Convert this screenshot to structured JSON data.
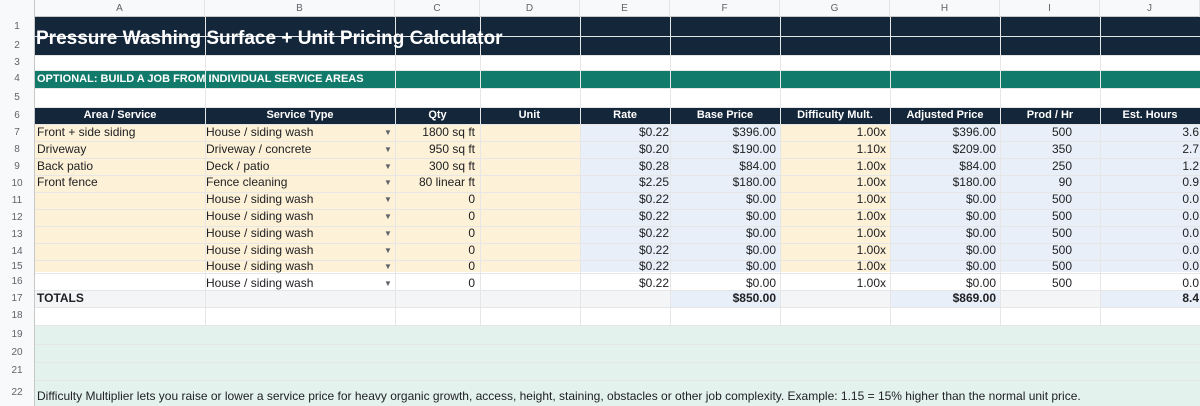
{
  "sheet": {
    "columns": [
      "A",
      "B",
      "C",
      "D",
      "E",
      "F",
      "G",
      "H",
      "I",
      "J"
    ],
    "row_numbers": [
      "1",
      "2",
      "3",
      "4",
      "5",
      "6",
      "7",
      "8",
      "9",
      "10",
      "11",
      "12",
      "13",
      "14",
      "15",
      "16",
      "17",
      "18",
      "19",
      "20",
      "21",
      "22"
    ],
    "title": "Pressure Washing Surface + Unit Pricing Calculator",
    "section_label": "OPTIONAL: BUILD A JOB FROM INDIVIDUAL SERVICE AREAS",
    "headers": {
      "area": "Area / Service",
      "service_type": "Service Type",
      "qty": "Qty",
      "unit": "Unit",
      "rate": "Rate",
      "base_price": "Base Price",
      "difficulty": "Difficulty Mult.",
      "adjusted": "Adjusted Price",
      "prod": "Prod / Hr",
      "hours": "Est. Hours"
    },
    "dropdown_glyph": "▼",
    "rows": [
      {
        "area": "Front + side siding",
        "service": "House / siding wash",
        "qty": "1800 sq ft",
        "unit": "",
        "rate": "$0.22",
        "base": "$396.00",
        "mult": "1.00x",
        "adj": "$396.00",
        "prod": "500",
        "hours": "3.6"
      },
      {
        "area": "Driveway",
        "service": "Driveway / concrete",
        "qty": "950 sq ft",
        "unit": "",
        "rate": "$0.20",
        "base": "$190.00",
        "mult": "1.10x",
        "adj": "$209.00",
        "prod": "350",
        "hours": "2.7"
      },
      {
        "area": "Back patio",
        "service": "Deck / patio",
        "qty": "300 sq ft",
        "unit": "",
        "rate": "$0.28",
        "base": "$84.00",
        "mult": "1.00x",
        "adj": "$84.00",
        "prod": "250",
        "hours": "1.2"
      },
      {
        "area": "Front fence",
        "service": "Fence cleaning",
        "qty": "80 linear ft",
        "unit": "",
        "rate": "$2.25",
        "base": "$180.00",
        "mult": "1.00x",
        "adj": "$180.00",
        "prod": "90",
        "hours": "0.9"
      },
      {
        "area": "",
        "service": "House / siding wash",
        "qty": "0",
        "unit": "",
        "rate": "$0.22",
        "base": "$0.00",
        "mult": "1.00x",
        "adj": "$0.00",
        "prod": "500",
        "hours": "0.0"
      },
      {
        "area": "",
        "service": "House / siding wash",
        "qty": "0",
        "unit": "",
        "rate": "$0.22",
        "base": "$0.00",
        "mult": "1.00x",
        "adj": "$0.00",
        "prod": "500",
        "hours": "0.0"
      },
      {
        "area": "",
        "service": "House / siding wash",
        "qty": "0",
        "unit": "",
        "rate": "$0.22",
        "base": "$0.00",
        "mult": "1.00x",
        "adj": "$0.00",
        "prod": "500",
        "hours": "0.0"
      },
      {
        "area": "",
        "service": "House / siding wash",
        "qty": "0",
        "unit": "",
        "rate": "$0.22",
        "base": "$0.00",
        "mult": "1.00x",
        "adj": "$0.00",
        "prod": "500",
        "hours": "0.0"
      },
      {
        "area": "",
        "service": "House / siding wash",
        "qty": "0",
        "unit": "",
        "rate": "$0.22",
        "base": "$0.00",
        "mult": "1.00x",
        "adj": "$0.00",
        "prod": "500",
        "hours": "0.0"
      },
      {
        "area": "",
        "service": "House / siding wash",
        "qty": "0",
        "unit": "",
        "rate": "$0.22",
        "base": "$0.00",
        "mult": "1.00x",
        "adj": "$0.00",
        "prod": "500",
        "hours": "0.0"
      }
    ],
    "totals": {
      "label": "TOTALS",
      "base": "$850.00",
      "adj": "$869.00",
      "hours": "8.4"
    },
    "note": "Difficulty Multiplier lets you raise or lower a service price for heavy organic growth, access, height, staining, obstacles or other job complexity. Example: 1.15 = 15% higher than the normal unit price.",
    "colors": {
      "title_bg": "#14263a",
      "section_bg": "#127a6a",
      "input_fill": "#fdf1d7",
      "calc_fill": "#e8eff8",
      "note_fill": "#e4f2ee"
    }
  }
}
